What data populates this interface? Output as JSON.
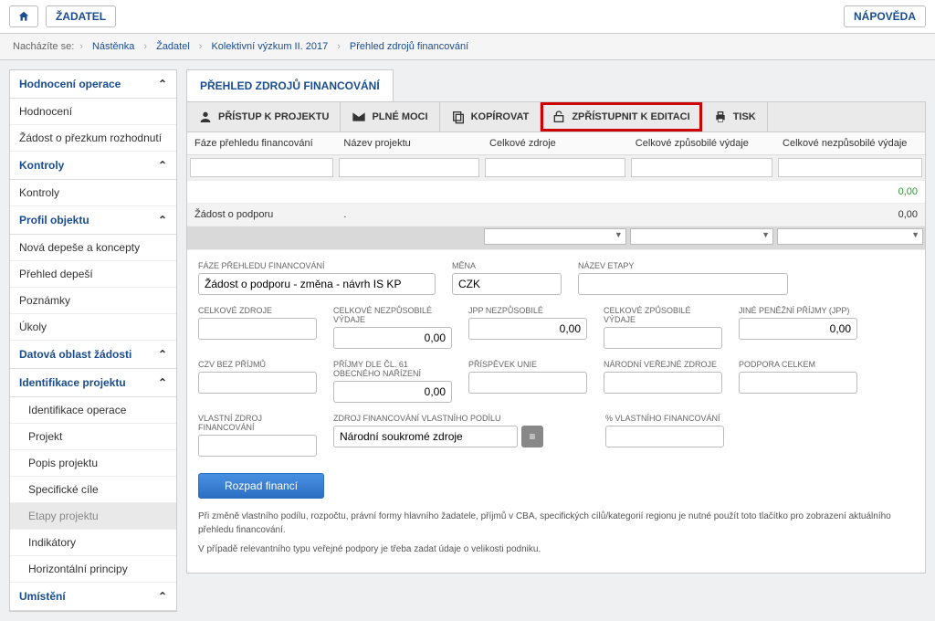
{
  "topbar": {
    "zadatel": "ŽADATEL",
    "napoveda": "NÁPOVĚDA"
  },
  "breadcrumb": {
    "label": "Nacházíte se:",
    "items": [
      "Nástěnka",
      "Žadatel",
      "Kolektivní výzkum II. 2017",
      "Přehled zdrojů financování"
    ]
  },
  "sidebar": {
    "groups": [
      {
        "title": "Hodnocení operace",
        "items": [
          "Hodnocení",
          "Žádost o přezkum rozhodnutí"
        ]
      },
      {
        "title": "Kontroly",
        "items": [
          "Kontroly"
        ]
      },
      {
        "title": "Profil objektu",
        "items": [
          "Nová depeše a koncepty",
          "Přehled depeší",
          "Poznámky",
          "Úkoly"
        ]
      },
      {
        "title": "Datová oblast žádosti",
        "items": []
      },
      {
        "title": "Identifikace projektu",
        "items": [
          "Identifikace operace",
          "Projekt",
          "Popis projektu",
          "Specifické cíle",
          "Etapy projektu",
          "Indikátory",
          "Horizontální principy"
        ]
      }
    ],
    "umisteni": "Umístění"
  },
  "panel": {
    "title": "PŘEHLED ZDROJŮ FINANCOVÁNÍ",
    "toolbar": {
      "pristup": "PŘÍSTUP K PROJEKTU",
      "plnemoci": "PLNÉ MOCI",
      "kopirovat": "KOPÍROVAT",
      "zpristupnit": "ZPŘÍSTUPNIT K EDITACI",
      "tisk": "TISK"
    },
    "grid": {
      "headers": {
        "faze": "Fáze přehledu financování",
        "nazev": "Název projektu",
        "celkove_zdroje": "Celkové zdroje",
        "celkove_zpusobile": "Celkové způsobilé výdaje",
        "celkove_nezpusobile": "Celkové nezpůsobilé výdaje"
      },
      "rows": [
        {
          "faze": "",
          "nazev": "",
          "celkove_zdroje": "",
          "celkove_zpusobile": "",
          "celkove_nezpusobile": "0,00"
        },
        {
          "faze": "Žádost o podporu",
          "nazev": ".",
          "celkove_zdroje": "",
          "celkove_zpusobile": "",
          "celkove_nezpusobile": "0,00"
        }
      ]
    },
    "form": {
      "labels": {
        "faze": "FÁZE PŘEHLEDU FINANCOVÁNÍ",
        "mena": "MĚNA",
        "nazev_etapy": "NÁZEV ETAPY",
        "celkove_zdroje": "CELKOVÉ ZDROJE",
        "celkove_nezpusobile": "CELKOVÉ NEZPŮSOBILÉ VÝDAJE",
        "jpp_nezpusobile": "JPP NEZPŮSOBILÉ",
        "celkove_zpusobile": "CELKOVÉ ZPŮSOBILÉ VÝDAJE",
        "jpp": "JINÉ PENĚŽNÍ PŘÍJMY (JPP)",
        "czv": "CZV BEZ PŘÍJMŮ",
        "prijmy61": "PŘÍJMY DLE ČL. 61 OBECNÉHO NAŘÍZENÍ",
        "prispevek_unie": "PŘÍSPĚVEK UNIE",
        "narodni": "NÁRODNÍ VEŘEJNÉ ZDROJE",
        "podpora": "PODPORA CELKEM",
        "vlastni_zdroj": "VLASTNÍ ZDROJ FINANCOVÁNÍ",
        "zdroj_vlastniho": "ZDROJ FINANCOVÁNÍ VLASTNÍHO PODÍLU",
        "pct_vlastniho": "% VLASTNÍHO FINANCOVÁNÍ"
      },
      "values": {
        "faze": "Žádost o podporu - změna - návrh IS KP",
        "mena": "CZK",
        "nazev_etapy": "",
        "celkove_zdroje": "",
        "celkove_nezpusobile": "0,00",
        "jpp_nezpusobile": "0,00",
        "celkove_zpusobile": "",
        "jpp": "0,00",
        "czv": "",
        "prijmy61": "0,00",
        "prispevek_unie": "",
        "narodni": "",
        "podpora": "",
        "vlastni_zdroj": "",
        "zdroj_vlastniho": "Národní soukromé zdroje",
        "pct_vlastniho": ""
      },
      "action": "Rozpad financí",
      "note1": "Při změně vlastního podílu, rozpočtu, právní formy hlavního žadatele, příjmů v CBA, specifických cílů/kategorií regionu je nutné použít toto tlačítko pro zobrazení aktuálního přehledu financování.",
      "note2": "V případě relevantního typu veřejné podpory je třeba zadat údaje o velikosti podniku."
    }
  }
}
